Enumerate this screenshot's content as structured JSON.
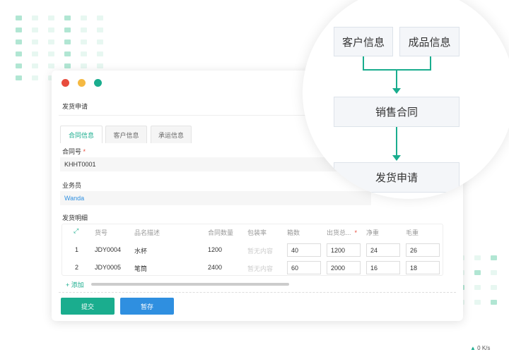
{
  "window": {
    "title": "发货申请",
    "dots": [
      "#e84c3d",
      "#f5b942",
      "#1aad8e"
    ]
  },
  "tabs": [
    {
      "label": "合同信息",
      "active": true
    },
    {
      "label": "客户信息"
    },
    {
      "label": "承运信息"
    }
  ],
  "form": {
    "contract_label": "合同号",
    "required_mark": "*",
    "contract_value": "KHHT0001",
    "salesman_label": "业务员",
    "salesman_value": "Wanda",
    "detail_label": "发货明细"
  },
  "table": {
    "headers": [
      "货号",
      "品名描述",
      "合同数量",
      "包装率",
      "箱数",
      "出货总...",
      "净重",
      "毛重"
    ],
    "rows": [
      {
        "idx": "1",
        "code": "JDY0004",
        "name": "水杯",
        "qty": "1200",
        "pack": "暂无内容",
        "boxes": "40",
        "total": "1200",
        "net": "24",
        "gross": "26"
      },
      {
        "idx": "2",
        "code": "JDY0005",
        "name": "笔筒",
        "qty": "2400",
        "pack": "暂无内容",
        "boxes": "60",
        "total": "2000",
        "net": "16",
        "gross": "18"
      }
    ],
    "add_label": "+ 添加"
  },
  "buttons": {
    "submit": "提交",
    "save": "暂存"
  },
  "flow": {
    "customer": "客户信息",
    "product": "成品信息",
    "contract": "销售合同",
    "shipment": "发货申请"
  },
  "status": "0 K/s",
  "accent": "#1aad8e",
  "blue": "#2f8fe0"
}
